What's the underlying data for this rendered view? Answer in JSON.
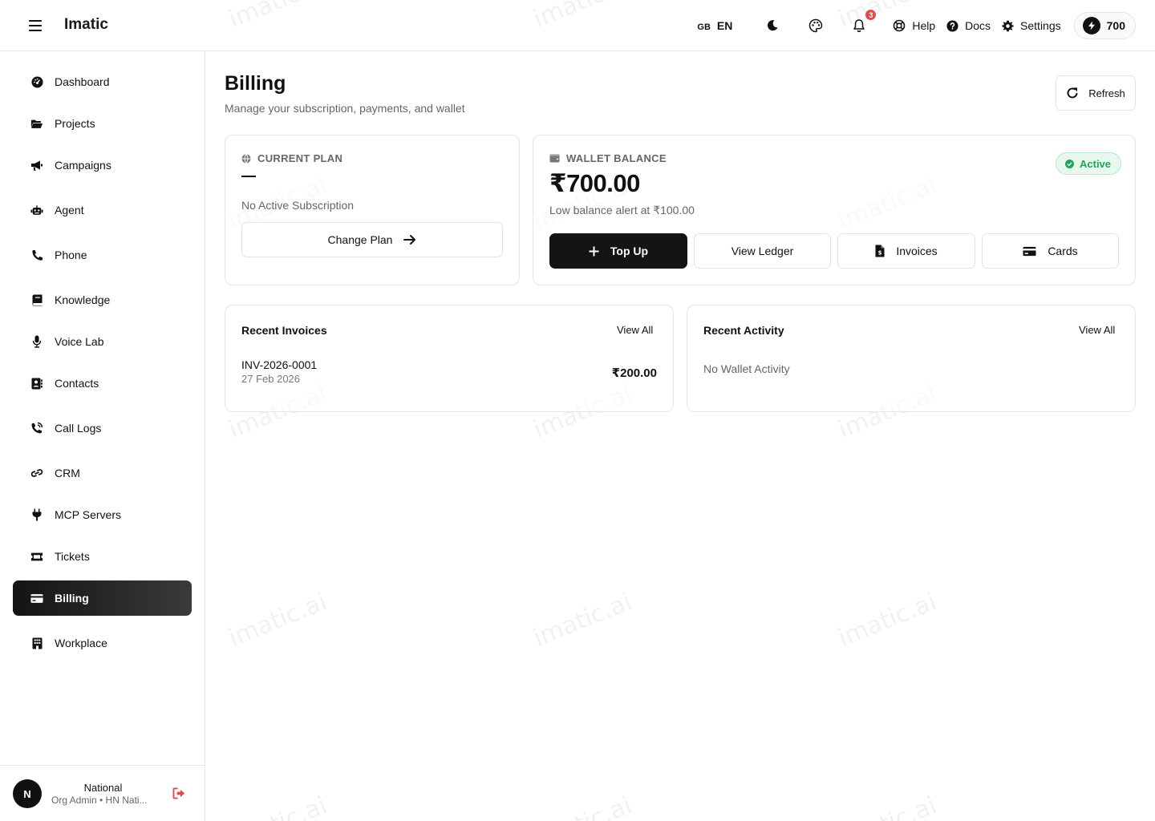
{
  "header": {
    "app_title": "Imatic",
    "language": {
      "flag": "GB",
      "code": "EN"
    },
    "notifications_count": "3",
    "links": {
      "help": "Help",
      "docs": "Docs",
      "settings": "Settings"
    },
    "credits": "700"
  },
  "sidebar": {
    "items": [
      {
        "label": "Dashboard",
        "icon": "dashboard-icon"
      },
      {
        "label": "Projects",
        "icon": "folder-icon"
      },
      {
        "label": "Campaigns",
        "icon": "megaphone-icon"
      },
      {
        "label": "Agent",
        "icon": "robot-icon"
      },
      {
        "label": "Phone",
        "icon": "phone-icon"
      },
      {
        "label": "Knowledge",
        "icon": "book-icon"
      },
      {
        "label": "Voice Lab",
        "icon": "microphone-icon"
      },
      {
        "label": "Contacts",
        "icon": "address-book-icon"
      },
      {
        "label": "Call Logs",
        "icon": "phone-volume-icon"
      },
      {
        "label": "CRM",
        "icon": "link-icon"
      },
      {
        "label": "MCP Servers",
        "icon": "plug-icon"
      },
      {
        "label": "Tickets",
        "icon": "ticket-icon"
      },
      {
        "label": "Billing",
        "icon": "credit-card-icon",
        "active": true
      },
      {
        "label": "Workplace",
        "icon": "building-icon"
      }
    ],
    "user": {
      "initial": "N",
      "name": "National",
      "role": "Org Admin • HN Nati..."
    }
  },
  "page": {
    "title": "Billing",
    "subtitle": "Manage your subscription, payments, and wallet",
    "refresh_label": "Refresh"
  },
  "current_plan": {
    "label": "CURRENT PLAN",
    "value": "—",
    "status_text": "No Active Subscription",
    "change_plan_label": "Change Plan"
  },
  "wallet": {
    "label": "WALLET BALANCE",
    "status": "Active",
    "balance": "₹700.00",
    "low_balance_alert": "Low balance alert at ₹100.00",
    "actions": {
      "top_up": "Top Up",
      "view_ledger": "View Ledger",
      "invoices": "Invoices",
      "cards": "Cards"
    }
  },
  "recent_invoices": {
    "title": "Recent Invoices",
    "view_all": "View All",
    "rows": [
      {
        "id": "INV-2026-0001",
        "date": "27 Feb 2026",
        "amount": "₹200.00"
      }
    ]
  },
  "recent_activity": {
    "title": "Recent Activity",
    "view_all": "View All",
    "empty_text": "No Wallet Activity"
  },
  "watermark_text": "imatic.ai",
  "colors": {
    "primary": "#141414",
    "active_green": "#22a55b",
    "badge_red": "#e5484d",
    "logout_red": "#e5484d"
  }
}
